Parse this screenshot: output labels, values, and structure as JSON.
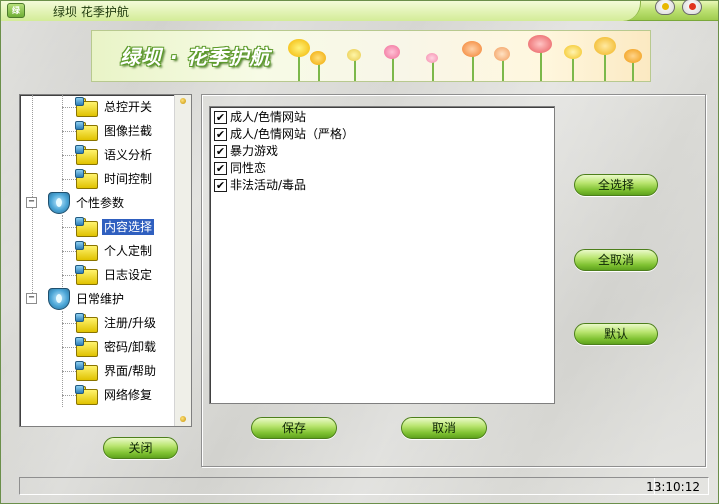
{
  "window": {
    "title": "绿坝 花季护航",
    "icon": "app-shield-icon"
  },
  "banner": {
    "title": "绿坝 · 花季护航"
  },
  "tree": {
    "items": [
      {
        "label": "总控开关",
        "type": "leaf"
      },
      {
        "label": "图像拦截",
        "type": "leaf"
      },
      {
        "label": "语义分析",
        "type": "leaf"
      },
      {
        "label": "时间控制",
        "type": "leaf"
      },
      {
        "label": "个性参数",
        "type": "group",
        "expanded": true
      },
      {
        "label": "内容选择",
        "type": "leaf",
        "selected": true
      },
      {
        "label": "个人定制",
        "type": "leaf"
      },
      {
        "label": "日志设定",
        "type": "leaf"
      },
      {
        "label": "日常维护",
        "type": "group",
        "expanded": true
      },
      {
        "label": "注册/升级",
        "type": "leaf"
      },
      {
        "label": "密码/卸载",
        "type": "leaf"
      },
      {
        "label": "界面/帮助",
        "type": "leaf"
      },
      {
        "label": "网络修复",
        "type": "leaf"
      }
    ],
    "expander_symbol": "−"
  },
  "content_list": {
    "items": [
      {
        "label": "成人/色情网站",
        "checked": true
      },
      {
        "label": "成人/色情网站（严格）",
        "checked": true
      },
      {
        "label": "暴力游戏",
        "checked": true
      },
      {
        "label": "同性恋",
        "checked": true
      },
      {
        "label": "非法活动/毒品",
        "checked": true
      }
    ],
    "check_mark": "✔"
  },
  "buttons": {
    "select_all": "全选择",
    "deselect_all": "全取消",
    "default": "默认",
    "save": "保存",
    "cancel": "取消",
    "close": "关闭"
  },
  "status": {
    "time": "13:10:12"
  },
  "colors": {
    "accent_green": "#7fc232",
    "selection_blue": "#2f5fbf",
    "title_bar": "#bfe276"
  }
}
